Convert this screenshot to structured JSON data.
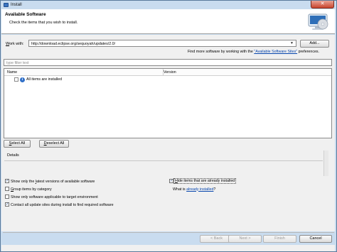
{
  "window": {
    "title": "Install",
    "close_label": "✕"
  },
  "header": {
    "title": "Available Software",
    "description": "Check the items that you wish to install."
  },
  "work_with": {
    "label_prefix": "W",
    "label_rest": "ork with:",
    "value": "http://download.eclipse.org/sequoyah/updates/2.0/",
    "add_label": "Add...",
    "hint_prefix": "Find more software by working with the ",
    "hint_link": "\"Available Software Sites\"",
    "hint_suffix": " preferences."
  },
  "filter": {
    "placeholder": "type filter text"
  },
  "table": {
    "columns": [
      "Name",
      "Version"
    ],
    "rows": [
      {
        "label": "All items are installed"
      }
    ]
  },
  "buttons": {
    "select_all_prefix": "S",
    "select_all_rest": "elect All",
    "deselect_all_prefix": "D",
    "deselect_all_rest": "eselect All"
  },
  "details": {
    "label": "Details"
  },
  "options": {
    "latest_a": "Show only the ",
    "latest_b": "l",
    "latest_c": "atest versions of available software",
    "latest_checked": true,
    "group_a": "G",
    "group_b": "roup items by category",
    "group_checked": false,
    "applicable": "Show only software applicable to target environment",
    "applicable_checked": false,
    "contact_a": "Contact all update sites during install to find required software",
    "contact_checked": true,
    "hide_a": "H",
    "hide_b": "ide items that are already installed",
    "hide_checked": true,
    "what_is_prefix": "What is ",
    "what_is_link": "already installed",
    "what_is_suffix": "?"
  },
  "footer": {
    "back": "< Back",
    "next": "Next >",
    "finish": "Finish",
    "cancel": "Cancel"
  },
  "colors": {
    "link": "#0645ad",
    "close": "#c8452e",
    "frame": "#c9dcef"
  }
}
